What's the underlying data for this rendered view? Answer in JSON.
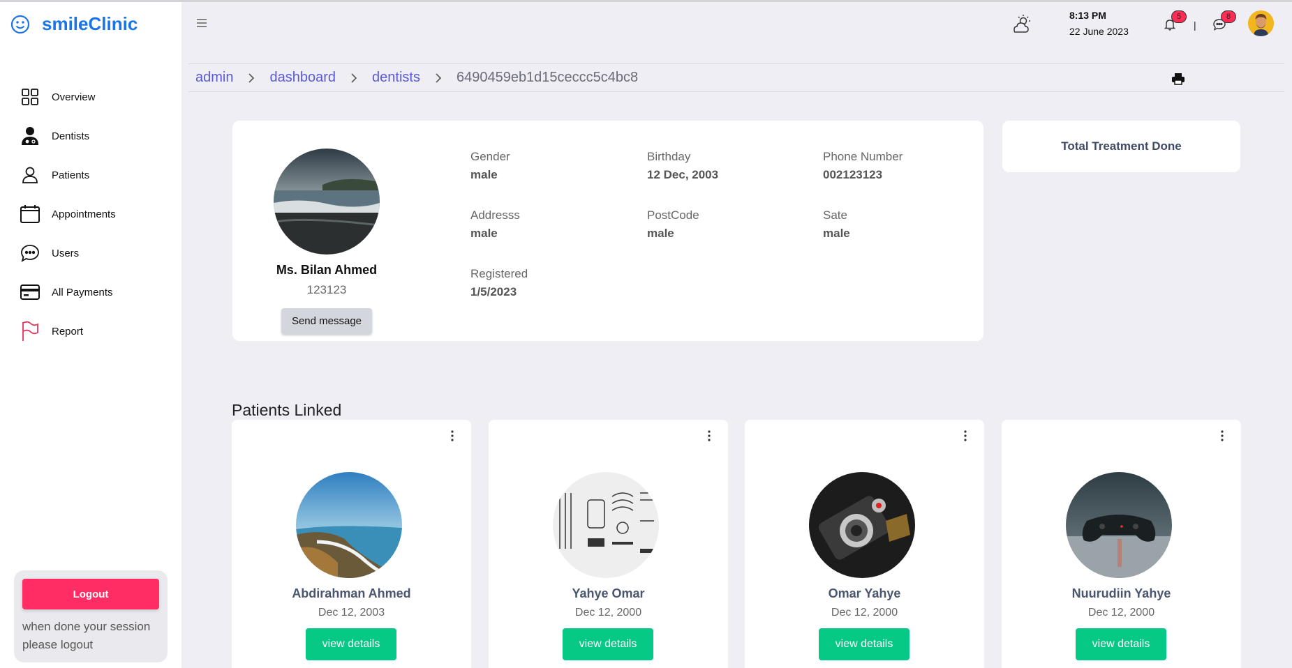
{
  "app": {
    "name": "smileClinic"
  },
  "sidebar": {
    "items": [
      {
        "label": "Overview",
        "icon": "grid-icon"
      },
      {
        "label": "Dentists",
        "icon": "doctor-icon"
      },
      {
        "label": "Patients",
        "icon": "person-icon"
      },
      {
        "label": "Appointments",
        "icon": "calendar-icon"
      },
      {
        "label": "Users",
        "icon": "chat-bubble-icon"
      },
      {
        "label": "All Payments",
        "icon": "credit-card-icon"
      },
      {
        "label": "Report",
        "icon": "flag-icon"
      }
    ],
    "logout": {
      "label": "Logout",
      "note": "when done your session please logout"
    }
  },
  "header": {
    "time": "8:13 PM",
    "date": "22 June 2023",
    "notifications_count": "5",
    "messages_count": "8",
    "separator": "|"
  },
  "breadcrumb": {
    "items": [
      "admin",
      "dashboard",
      "dentists"
    ],
    "current": "6490459eb1d15ceccc5c4bc8"
  },
  "profile": {
    "name": "Ms. Bilan Ahmed",
    "id": "123123",
    "send_label": "Send message",
    "fields": {
      "gender": {
        "label": "Gender",
        "value": "male"
      },
      "birthday": {
        "label": "Birthday",
        "value": "12 Dec, 2003"
      },
      "phone": {
        "label": "Phone Number",
        "value": "002123123"
      },
      "address": {
        "label": "Addresss",
        "value": "male"
      },
      "postcode": {
        "label": "PostCode",
        "value": "male"
      },
      "state": {
        "label": "Sate",
        "value": "male"
      },
      "registered": {
        "label": "Registered",
        "value": "1/5/2023"
      }
    }
  },
  "treatment": {
    "title": "Total Treatment Done"
  },
  "patients_section": {
    "title": "Patients Linked",
    "button_label": "view details",
    "patients": [
      {
        "name": "Abdirahman Ahmed",
        "date": "Dec 12, 2003"
      },
      {
        "name": "Yahye Omar",
        "date": "Dec 12, 2000"
      },
      {
        "name": "Omar Yahye",
        "date": "Dec 12, 2000"
      },
      {
        "name": "Nuurudiin Yahye",
        "date": "Dec 12, 2000"
      }
    ]
  },
  "colors": {
    "brand": "#1a73e8",
    "logout": "#ff2d63",
    "view_button": "#06c985",
    "breadcrumb_link": "#5a5ad6",
    "badge": "#ff2d55"
  }
}
